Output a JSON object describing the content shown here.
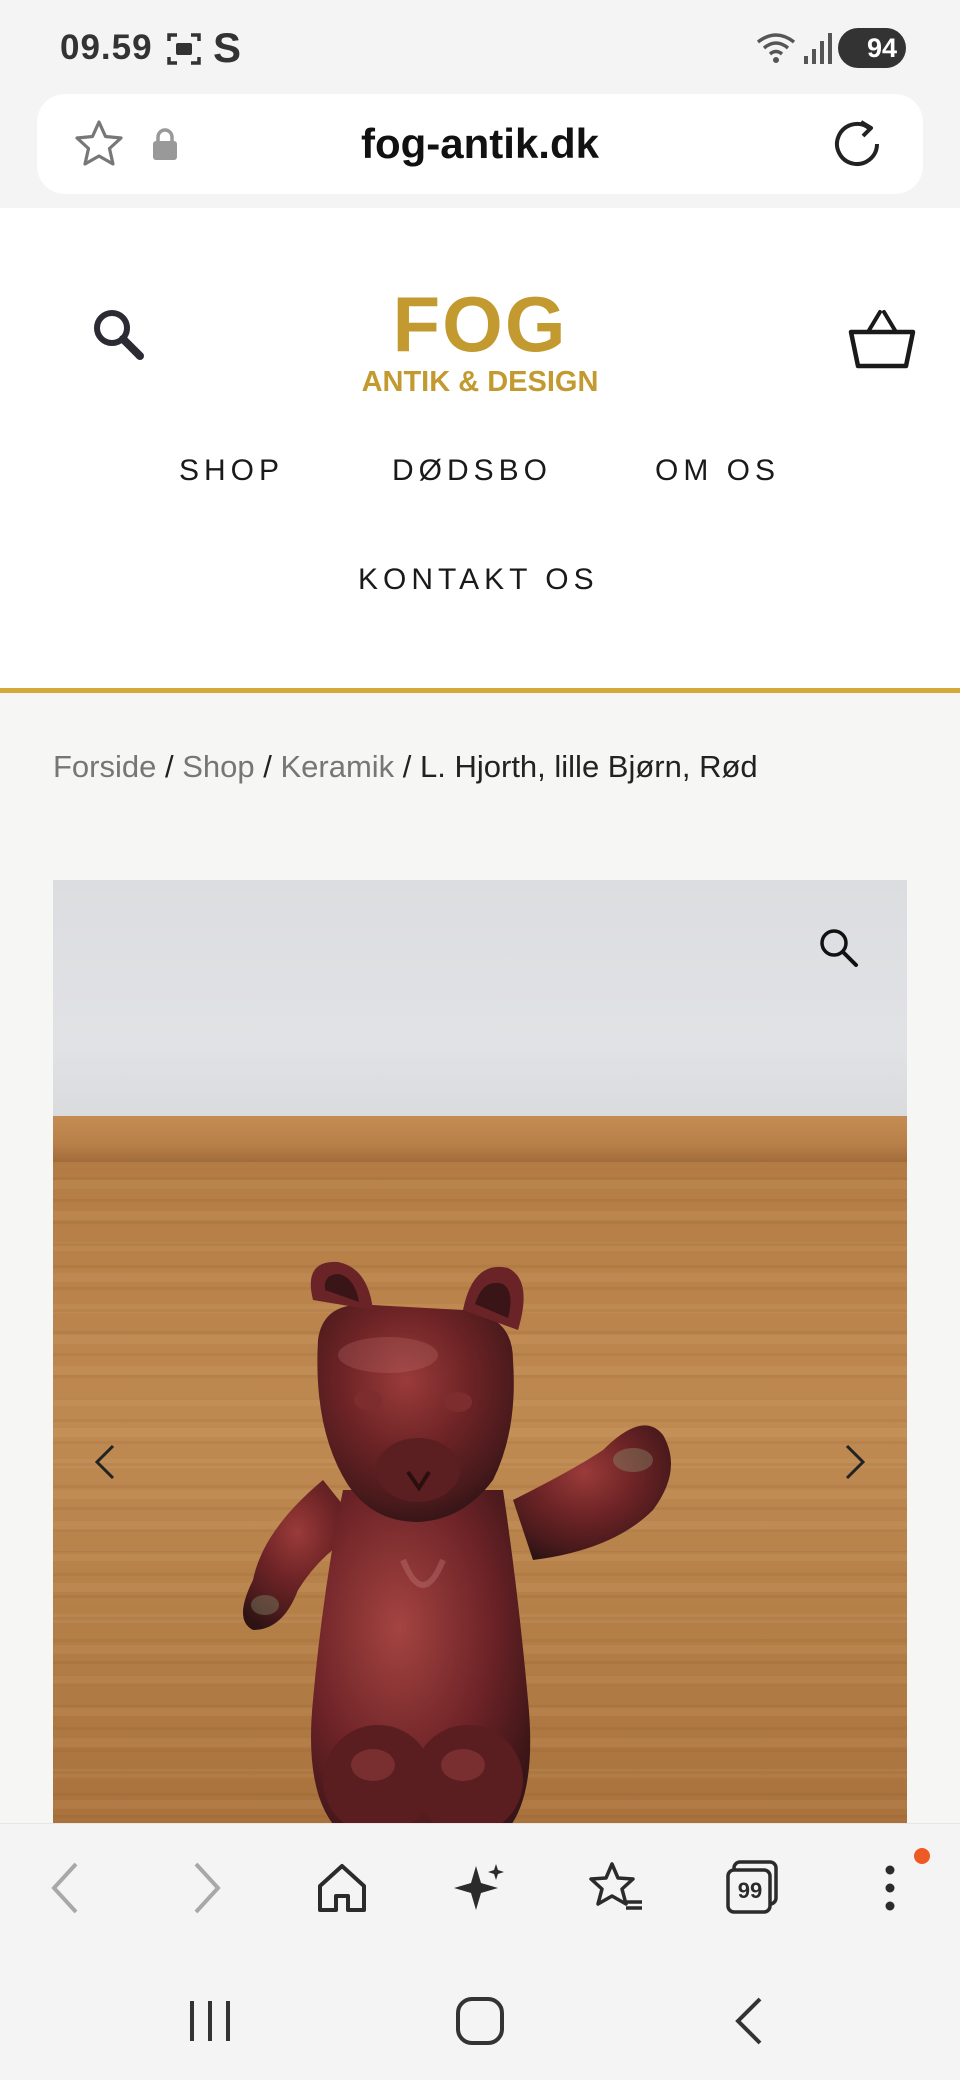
{
  "status_bar": {
    "time": "09.59",
    "s_indicator": "S",
    "battery": "94",
    "icons": [
      "screenshot-icon",
      "wifi-icon",
      "signal-icon",
      "battery-icon"
    ]
  },
  "browser": {
    "url": "fog-antik.dk",
    "icons": [
      "star-icon",
      "lock-icon",
      "reload-icon"
    ]
  },
  "header": {
    "logo_main": "FOG",
    "logo_sub": "ANTIK & DESIGN",
    "nav": [
      "SHOP",
      "DØDSBO",
      "OM OS",
      "KONTAKT OS"
    ]
  },
  "breadcrumb": {
    "items": [
      "Forside",
      "Shop",
      "Keramik"
    ],
    "separator": " / ",
    "current": "L. Hjorth, lille Bjørn, Rød"
  },
  "colors": {
    "brand_gold": "#c29a30",
    "rule_gold": "#d4a93a",
    "notification": "#ee5a24"
  },
  "bottom_bar": {
    "tabs_count": "99",
    "icons": [
      "back-icon",
      "forward-icon",
      "home-icon",
      "ai-sparkle-icon",
      "bookmarks-icon",
      "tabs-icon",
      "more-icon"
    ]
  },
  "system_nav": {
    "icons": [
      "recents-icon",
      "home-button-icon",
      "system-back-icon"
    ]
  }
}
